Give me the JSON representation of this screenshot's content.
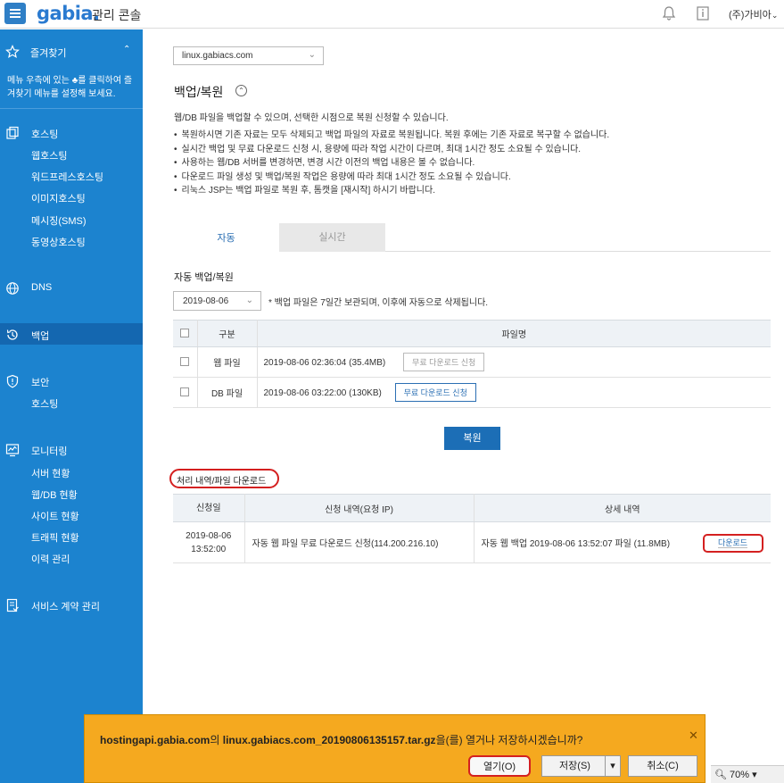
{
  "topbar": {
    "logo": "gabia.",
    "console_title": "관리 콘솔",
    "account": "(주)가비아"
  },
  "sidebar": {
    "favorites_label": "즐겨찾기",
    "favorites_desc": "메뉴 우측에 있는 ♣를 클릭하여 즐겨찾기 메뉴를 설정해 보세요.",
    "hosting": {
      "title": "호스팅",
      "items": [
        "웹호스팅",
        "워드프레스호스팅",
        "이미지호스팅",
        "메시징(SMS)",
        "동영상호스팅"
      ]
    },
    "dns": "DNS",
    "backup": "백업",
    "security": {
      "title": "보안",
      "items": [
        "호스팅"
      ]
    },
    "monitoring": {
      "title": "모니터링",
      "items": [
        "서버 현황",
        "웹/DB 현황",
        "사이트 현황",
        "트래픽 현황",
        "이력 관리"
      ]
    },
    "contract": "서비스 계약 관리"
  },
  "main": {
    "domain": "linux.gabiacs.com",
    "title": "백업/복원",
    "desc": "웹/DB 파일을 백업할 수 있으며, 선택한 시점으로 복원 신청할 수 있습니다.",
    "bullets": [
      "복원하시면 기존 자료는 모두 삭제되고 백업 파일의 자료로 복원됩니다. 복원 후에는 기존 자료로 복구할 수 없습니다.",
      "실시간 백업 및 무료 다운로드 신청 시, 용량에 따라 작업 시간이 다르며, 최대 1시간 정도 소요될 수 있습니다.",
      "사용하는 웹/DB 서버를 변경하면, 변경 시간 이전의 백업 내용은 볼 수 없습니다.",
      "다운로드 파일 생성 및 백업/복원 작업은 용량에 따라 최대 1시간 정도 소요될 수 있습니다.",
      "리눅스 JSP는 백업 파일로 복원 후, 톰캣을 [재시작] 하시기 바랍니다."
    ],
    "tabs": {
      "auto": "자동",
      "realtime": "실시간"
    },
    "auto_title": "자동 백업/복원",
    "date": "2019-08-06",
    "date_note": "* 백업 파일은 7일간 보관되며, 이후에 자동으로 삭제됩니다.",
    "backup_table": {
      "headers": {
        "type": "구분",
        "file": "파일명"
      },
      "rows": [
        {
          "type": "웹 파일",
          "file": "2019-08-06 02:36:04 (35.4MB)",
          "button": "무료 다운로드 신청"
        },
        {
          "type": "DB 파일",
          "file": "2019-08-06 03:22:00 (130KB)",
          "button": "무료 다운로드 신청"
        }
      ]
    },
    "restore_button": "복원",
    "history_title": "처리 내역/파일 다운로드",
    "history_table": {
      "headers": {
        "date": "신청일",
        "request": "신청 내역(요청 IP)",
        "detail": "상세 내역"
      },
      "row": {
        "date_line1": "2019-08-06",
        "date_line2": "13:52:00",
        "request": "자동 웹 파일 무료 다운로드 신청(114.200.216.10)",
        "detail": "자동 웹 백업 2019-08-06 13:52:07 파일 (11.8MB)",
        "button": "다운로드"
      }
    }
  },
  "download_bar": {
    "host": "hostingapi.gabia.com",
    "mid1": "의 ",
    "filename": "linux.gabiacs.com_20190806135157.tar.gz",
    "mid2": "을(를) 열거나 저장하시겠습니까?",
    "open": "열기(O)",
    "save": "저장(S)",
    "cancel": "취소(C)"
  },
  "zoom": "70%"
}
